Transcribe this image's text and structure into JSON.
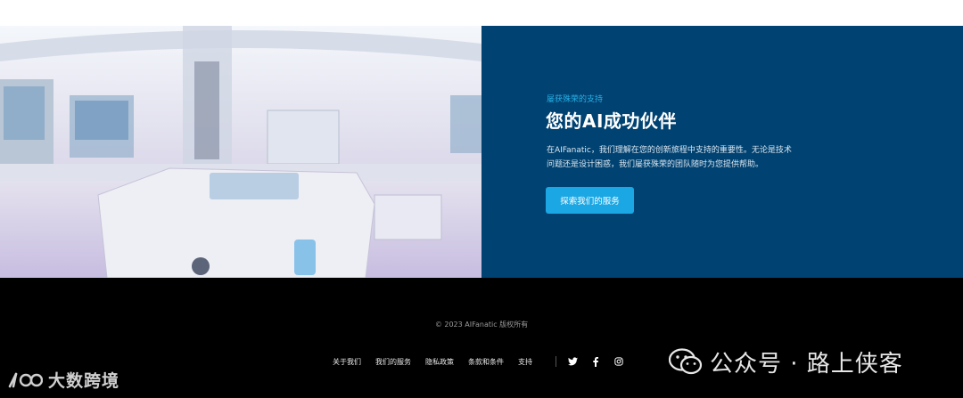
{
  "hero": {
    "eyebrow": "屡获殊荣的支持",
    "headline": "您的AI成功伙伴",
    "description": "在AIFanatic，我们理解在您的创新旅程中支持的重要性。无论是技术问题还是设计困惑，我们屡获殊荣的团队随时为您提供帮助。",
    "cta_label": "探索我们的服务",
    "panel_color": "#004271",
    "accent_color": "#1aa7e3"
  },
  "footer": {
    "copyright": "© 2023 AIFanatic 版权所有",
    "nav": [
      "关于我们",
      "我们的服务",
      "隐私政策",
      "条款和条件",
      "支持"
    ],
    "social_icons": [
      "twitter-icon",
      "facebook-icon",
      "instagram-icon"
    ]
  },
  "watermarks": {
    "left": "大数跨境",
    "right": "公众号 · 路上侠客"
  }
}
